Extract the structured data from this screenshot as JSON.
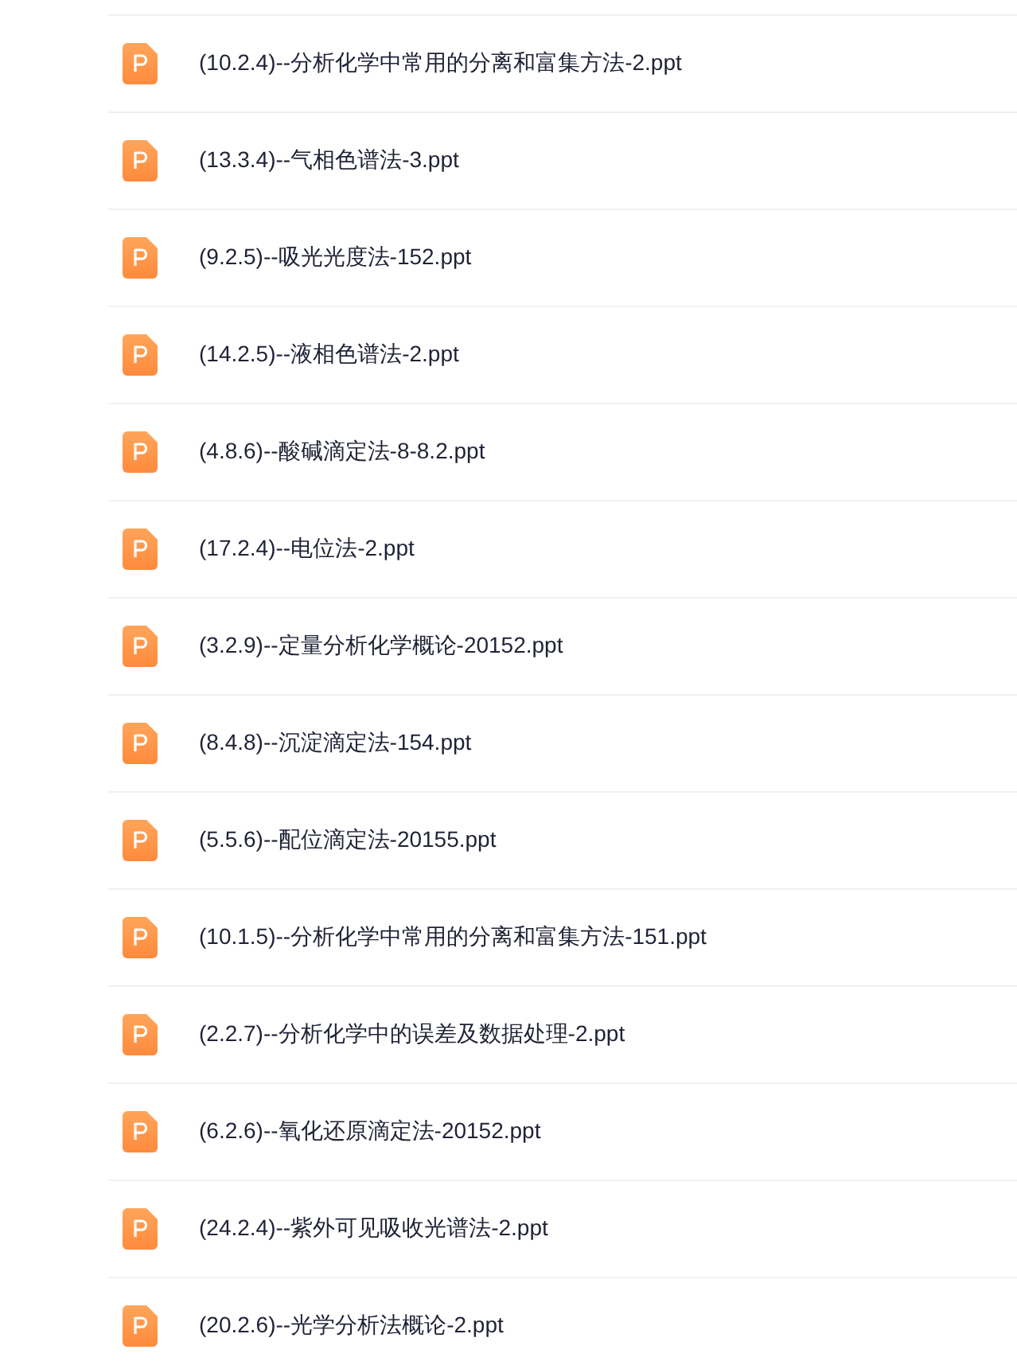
{
  "files": [
    {
      "name": "(10.2.4)--分析化学中常用的分离和富集方法-2.ppt"
    },
    {
      "name": "(13.3.4)--气相色谱法-3.ppt"
    },
    {
      "name": "(9.2.5)--吸光光度法-152.ppt"
    },
    {
      "name": "(14.2.5)--液相色谱法-2.ppt"
    },
    {
      "name": "(4.8.6)--酸碱滴定法-8-8.2.ppt"
    },
    {
      "name": "(17.2.4)--电位法-2.ppt"
    },
    {
      "name": "(3.2.9)--定量分析化学概论-20152.ppt"
    },
    {
      "name": "(8.4.8)--沉淀滴定法-154.ppt"
    },
    {
      "name": "(5.5.6)--配位滴定法-20155.ppt"
    },
    {
      "name": "(10.1.5)--分析化学中常用的分离和富集方法-151.ppt"
    },
    {
      "name": "(2.2.7)--分析化学中的误差及数据处理-2.ppt"
    },
    {
      "name": "(6.2.6)--氧化还原滴定法-20152.ppt"
    },
    {
      "name": "(24.2.4)--紫外可见吸收光谱法-2.ppt"
    },
    {
      "name": "(20.2.6)--光学分析法概论-2.ppt"
    }
  ]
}
